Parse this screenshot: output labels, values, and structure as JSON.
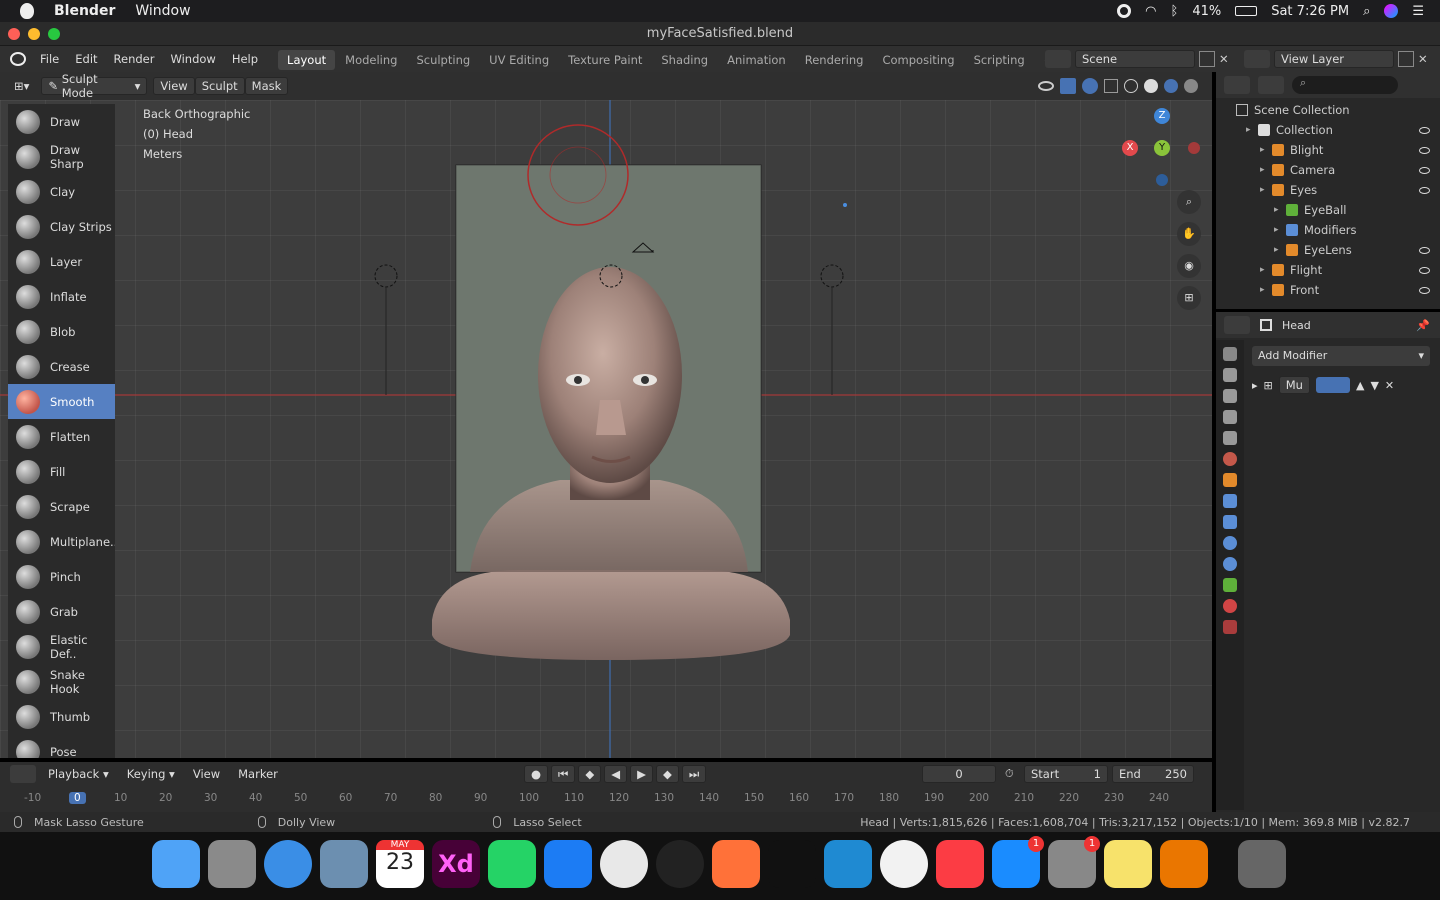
{
  "mac_menubar": {
    "app": "Blender",
    "menu": "Window",
    "battery": "41%",
    "clock": "Sat 7:26 PM"
  },
  "window": {
    "title": "myFaceSatisfied.blend"
  },
  "topmenu": {
    "items": [
      "File",
      "Edit",
      "Render",
      "Window",
      "Help"
    ],
    "workspaces": [
      "Layout",
      "Modeling",
      "Sculpting",
      "UV Editing",
      "Texture Paint",
      "Shading",
      "Animation",
      "Rendering",
      "Compositing",
      "Scripting"
    ],
    "active_workspace": "Layout",
    "scene": "Scene",
    "view_layer": "View Layer"
  },
  "viewport_header": {
    "mode": "Sculpt Mode",
    "menus": [
      "View",
      "Sculpt",
      "Mask"
    ]
  },
  "viewport_info": {
    "view": "Back Orthographic",
    "object": "(0) Head",
    "units": "Meters"
  },
  "tools": [
    "Draw",
    "Draw Sharp",
    "Clay",
    "Clay Strips",
    "Layer",
    "Inflate",
    "Blob",
    "Crease",
    "Smooth",
    "Flatten",
    "Fill",
    "Scrape",
    "Multiplane..",
    "Pinch",
    "Grab",
    "Elastic Def..",
    "Snake Hook",
    "Thumb",
    "Pose"
  ],
  "active_tool": "Smooth",
  "gizmo": {
    "x": "X",
    "y": "Y",
    "z": "Z"
  },
  "outliner": {
    "scene_collection": "Scene Collection",
    "rows": [
      {
        "label": "Collection",
        "indent": 1
      },
      {
        "label": "Blight",
        "indent": 2
      },
      {
        "label": "Camera",
        "indent": 2
      },
      {
        "label": "Eyes",
        "indent": 2
      },
      {
        "label": "EyeBall",
        "indent": 3
      },
      {
        "label": "Modifiers",
        "indent": 3
      },
      {
        "label": "EyeLens",
        "indent": 3
      },
      {
        "label": "Flight",
        "indent": 2
      },
      {
        "label": "Front",
        "indent": 2
      }
    ]
  },
  "properties": {
    "object": "Head",
    "add_modifier": "Add Modifier",
    "modifier_name": "Mu"
  },
  "timeline": {
    "menus": [
      "Playback",
      "Keying",
      "View",
      "Marker"
    ],
    "current_frame": "0",
    "start_label": "Start",
    "start": "1",
    "end_label": "End",
    "end": "250",
    "ticks": [
      "-10",
      "0",
      "10",
      "20",
      "30",
      "40",
      "50",
      "60",
      "70",
      "80",
      "90",
      "100",
      "110",
      "120",
      "130",
      "140",
      "150",
      "160",
      "170",
      "180",
      "190",
      "200",
      "210",
      "220",
      "230",
      "240"
    ]
  },
  "statusbar": {
    "left": "Mask Lasso Gesture",
    "middle": "Dolly View",
    "right_action": "Lasso Select",
    "stats": "Head | Verts:1,815,626 | Faces:1,608,704 | Tris:3,217,152 | Objects:1/10 | Mem: 369.8 MiB | v2.82.7"
  },
  "dock": {
    "apps": [
      "Finder",
      "Launchpad",
      "Safari",
      "Preview",
      "Calendar",
      "Adobe XD",
      "WhatsApp",
      "Xcode",
      "Chrome",
      "Siri",
      "Firefox",
      "Terminal",
      "VS Code",
      "Photos",
      "Music",
      "App Store",
      "System Preferences",
      "Stickies",
      "Blender",
      "Trash"
    ],
    "calendar_month": "MAY",
    "calendar_day": "23",
    "xd_label": "Xd",
    "appstore_badge": "1",
    "sysprefs_badge": "1"
  },
  "colors": {
    "accent": "#5680c2",
    "active_tab": "#454545",
    "x_axis": "#e2494c",
    "y_axis": "#8ac33a",
    "z_axis": "#3f86d8"
  }
}
